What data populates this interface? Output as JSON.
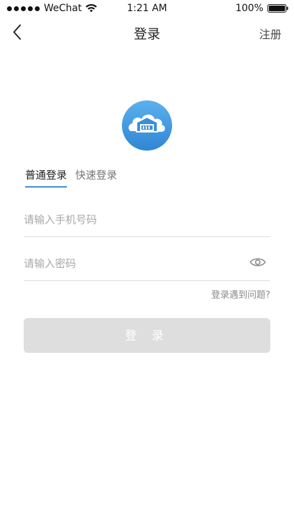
{
  "status_bar": {
    "carrier": "WeChat",
    "time": "1:21 AM",
    "battery": "100%"
  },
  "nav": {
    "title": "登录",
    "action": "注册",
    "back_icon": "chevron-left-icon"
  },
  "logo": {
    "icon": "warehouse-cloud-logo"
  },
  "tabs": [
    {
      "label": "普通登录",
      "active": true
    },
    {
      "label": "快速登录",
      "active": false
    }
  ],
  "form": {
    "phone_placeholder": "请输入手机号码",
    "phone_value": "",
    "password_placeholder": "请输入密码",
    "password_value": "",
    "help_link": "登录遇到问题?",
    "submit_label": "登 录"
  },
  "colors": {
    "accent": "#3d8fd6",
    "button_disabled": "#dedede",
    "placeholder": "#a8a8a8"
  }
}
